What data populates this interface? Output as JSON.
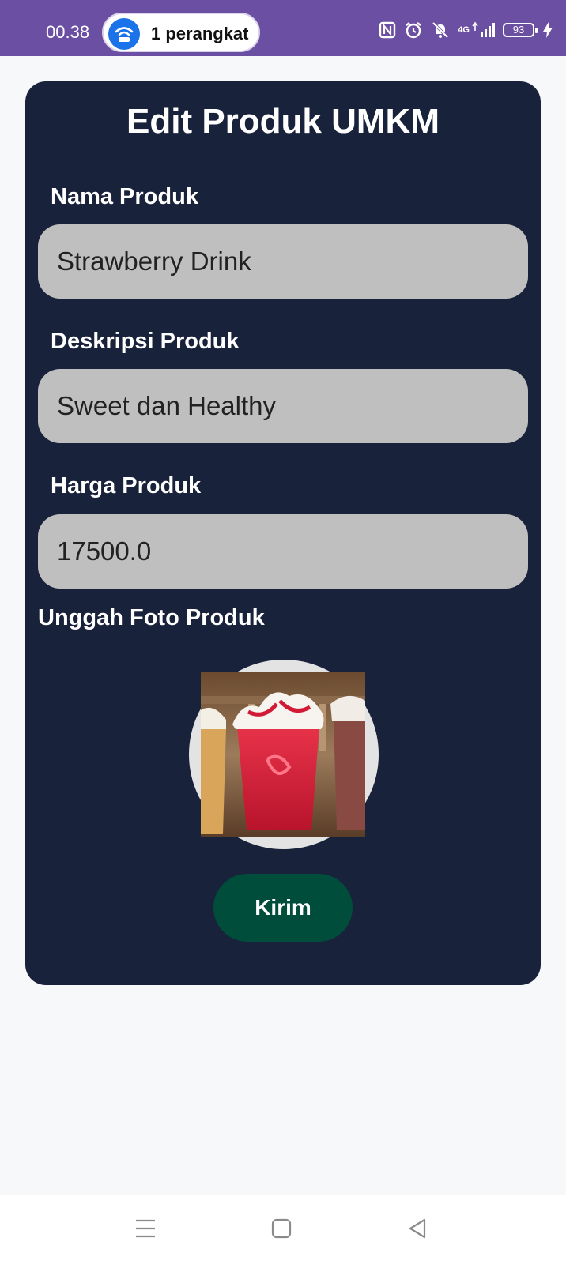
{
  "status_bar": {
    "time": "00.38",
    "hotspot_label": "1 perangkat",
    "network_label": "4G",
    "battery_level": "93",
    "icons": [
      "hotspot-icon",
      "nfc-icon",
      "alarm-icon",
      "mute-icon",
      "signal-icon",
      "battery-icon",
      "charging-icon"
    ]
  },
  "form": {
    "title": "Edit Produk UMKM",
    "name_label": "Nama Produk",
    "name_value": "Strawberry Drink",
    "description_label": "Deskripsi Produk",
    "description_value": "Sweet dan Healthy",
    "price_label": "Harga Produk",
    "price_value": "17500.0",
    "photo_label": "Unggah Foto Produk",
    "submit_label": "Kirim"
  },
  "nav_bar": {
    "icons": [
      "menu-icon",
      "home-icon",
      "back-icon"
    ]
  },
  "colors": {
    "status_bar": "#6a4fa2",
    "page_background": "#f7f8fa",
    "card_background": "#19223b",
    "input_background": "#bfbfbf",
    "button_background": "#004d3b",
    "hotspot_accent": "#1a73e8"
  }
}
